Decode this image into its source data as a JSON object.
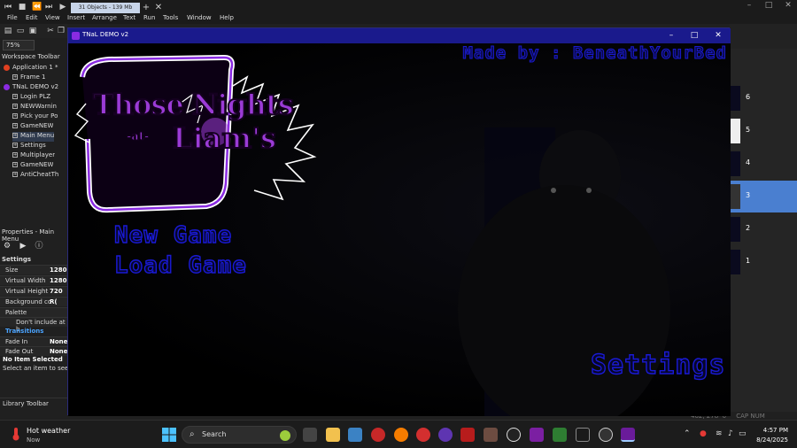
{
  "editor": {
    "tab_objects": "31 Objects - 139 Mb",
    "menu": [
      "File",
      "Edit",
      "View",
      "Insert",
      "Arrange",
      "Text",
      "Run",
      "Tools",
      "Window",
      "Help"
    ],
    "zoom": "75%",
    "workspace_toolbar": "Workspace Toolbar",
    "tree": [
      {
        "label": "Application 1 *",
        "indent": 1
      },
      {
        "label": "Frame 1",
        "indent": 2
      },
      {
        "label": "TNaL DEMO v2",
        "indent": 1
      },
      {
        "label": "Login PLZ",
        "indent": 2
      },
      {
        "label": "NEWWarnin",
        "indent": 2
      },
      {
        "label": "Pick your Po",
        "indent": 2
      },
      {
        "label": "GameNEW",
        "indent": 2
      },
      {
        "label": "Main Menu",
        "indent": 2
      },
      {
        "label": "Settings",
        "indent": 2
      },
      {
        "label": "Multiplayer",
        "indent": 2
      },
      {
        "label": "GameNEW",
        "indent": 2
      },
      {
        "label": "AntiCheatTh",
        "indent": 2
      }
    ],
    "properties_header": "Properties - Main Menu",
    "properties_tab": "Settings",
    "properties": [
      {
        "k": "Size",
        "v": "1280"
      },
      {
        "k": "Virtual Width",
        "v": "1280"
      },
      {
        "k": "Virtual Height",
        "v": "720"
      },
      {
        "k": "Background co",
        "v": "R("
      },
      {
        "k": "Palette",
        "v": ""
      }
    ],
    "dont_include": "Don't include at b",
    "transitions": "Transitions",
    "fade_in": {
      "k": "Fade In",
      "v": "None"
    },
    "fade_out": {
      "k": "Fade Out",
      "v": "None"
    },
    "no_item": "No Item Selected",
    "no_item_sub": "Select an item to see it",
    "library_toolbar": "Library Toolbar",
    "frames": [
      "6",
      "5",
      "4",
      "3",
      "2",
      "1"
    ],
    "selected_frame": "3",
    "status_coords": "462, 278",
    "status_zero": "0",
    "status_cap": "CAP NUM"
  },
  "game": {
    "window_title": "TNaL DEMO v2",
    "credit": "Made by : BeneathYourBed",
    "logo_line1": "Those Nights",
    "logo_line2": "-at-",
    "logo_line3": "Liam's",
    "new_game": "New Game",
    "load_game": "Load Game",
    "settings": "Settings"
  },
  "taskbar": {
    "weather_title": "Hot weather",
    "weather_sub": "Now",
    "search": "Search",
    "time": "4:57 PM",
    "date": "8/24/2025"
  }
}
